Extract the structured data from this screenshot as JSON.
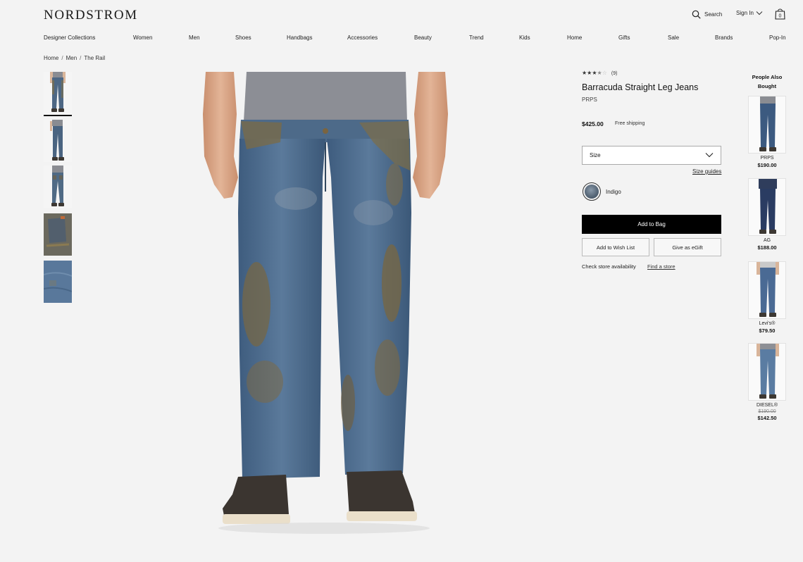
{
  "header": {
    "logo": "NORDSTROM",
    "search_label": "Search",
    "signin_label": "Sign In",
    "bag_count": "0"
  },
  "nav": [
    {
      "label": "Designer Collections"
    },
    {
      "label": "Women"
    },
    {
      "label": "Men"
    },
    {
      "label": "Shoes"
    },
    {
      "label": "Handbags"
    },
    {
      "label": "Accessories"
    },
    {
      "label": "Beauty"
    },
    {
      "label": "Trend"
    },
    {
      "label": "Kids"
    },
    {
      "label": "Home"
    },
    {
      "label": "Gifts"
    },
    {
      "label": "Sale"
    },
    {
      "label": "Brands"
    },
    {
      "label": "Pop-In"
    }
  ],
  "breadcrumb": [
    "Home",
    "Men",
    "The Rail"
  ],
  "product": {
    "rating": 3.5,
    "review_count": "(9)",
    "title": "Barracuda Straight Leg Jeans",
    "brand": "PRPS",
    "price": "$425.00",
    "shipping": "Free shipping",
    "size_placeholder": "Size",
    "size_guides": "Size guides",
    "color": "Indigo",
    "add_to_bag": "Add to Bag",
    "add_to_wishlist": "Add to Wish List",
    "give_egift": "Give as eGift",
    "store_availability": "Check store availability",
    "find_store": "Find a store"
  },
  "people_also_bought": {
    "title": "People Also Bought",
    "items": [
      {
        "brand": "PRPS",
        "price": "$190.00",
        "original_price": ""
      },
      {
        "brand": "AG",
        "price": "$188.00",
        "original_price": ""
      },
      {
        "brand": "Levi's®",
        "price": "$79.50",
        "original_price": ""
      },
      {
        "brand": "DIESEL®",
        "price": "$142.50",
        "original_price": "$190.00"
      }
    ]
  },
  "colors": {
    "accent": "#000000",
    "background": "#f3f3f3",
    "denim": "#4a6c8f",
    "mud": "#8a7a52"
  }
}
